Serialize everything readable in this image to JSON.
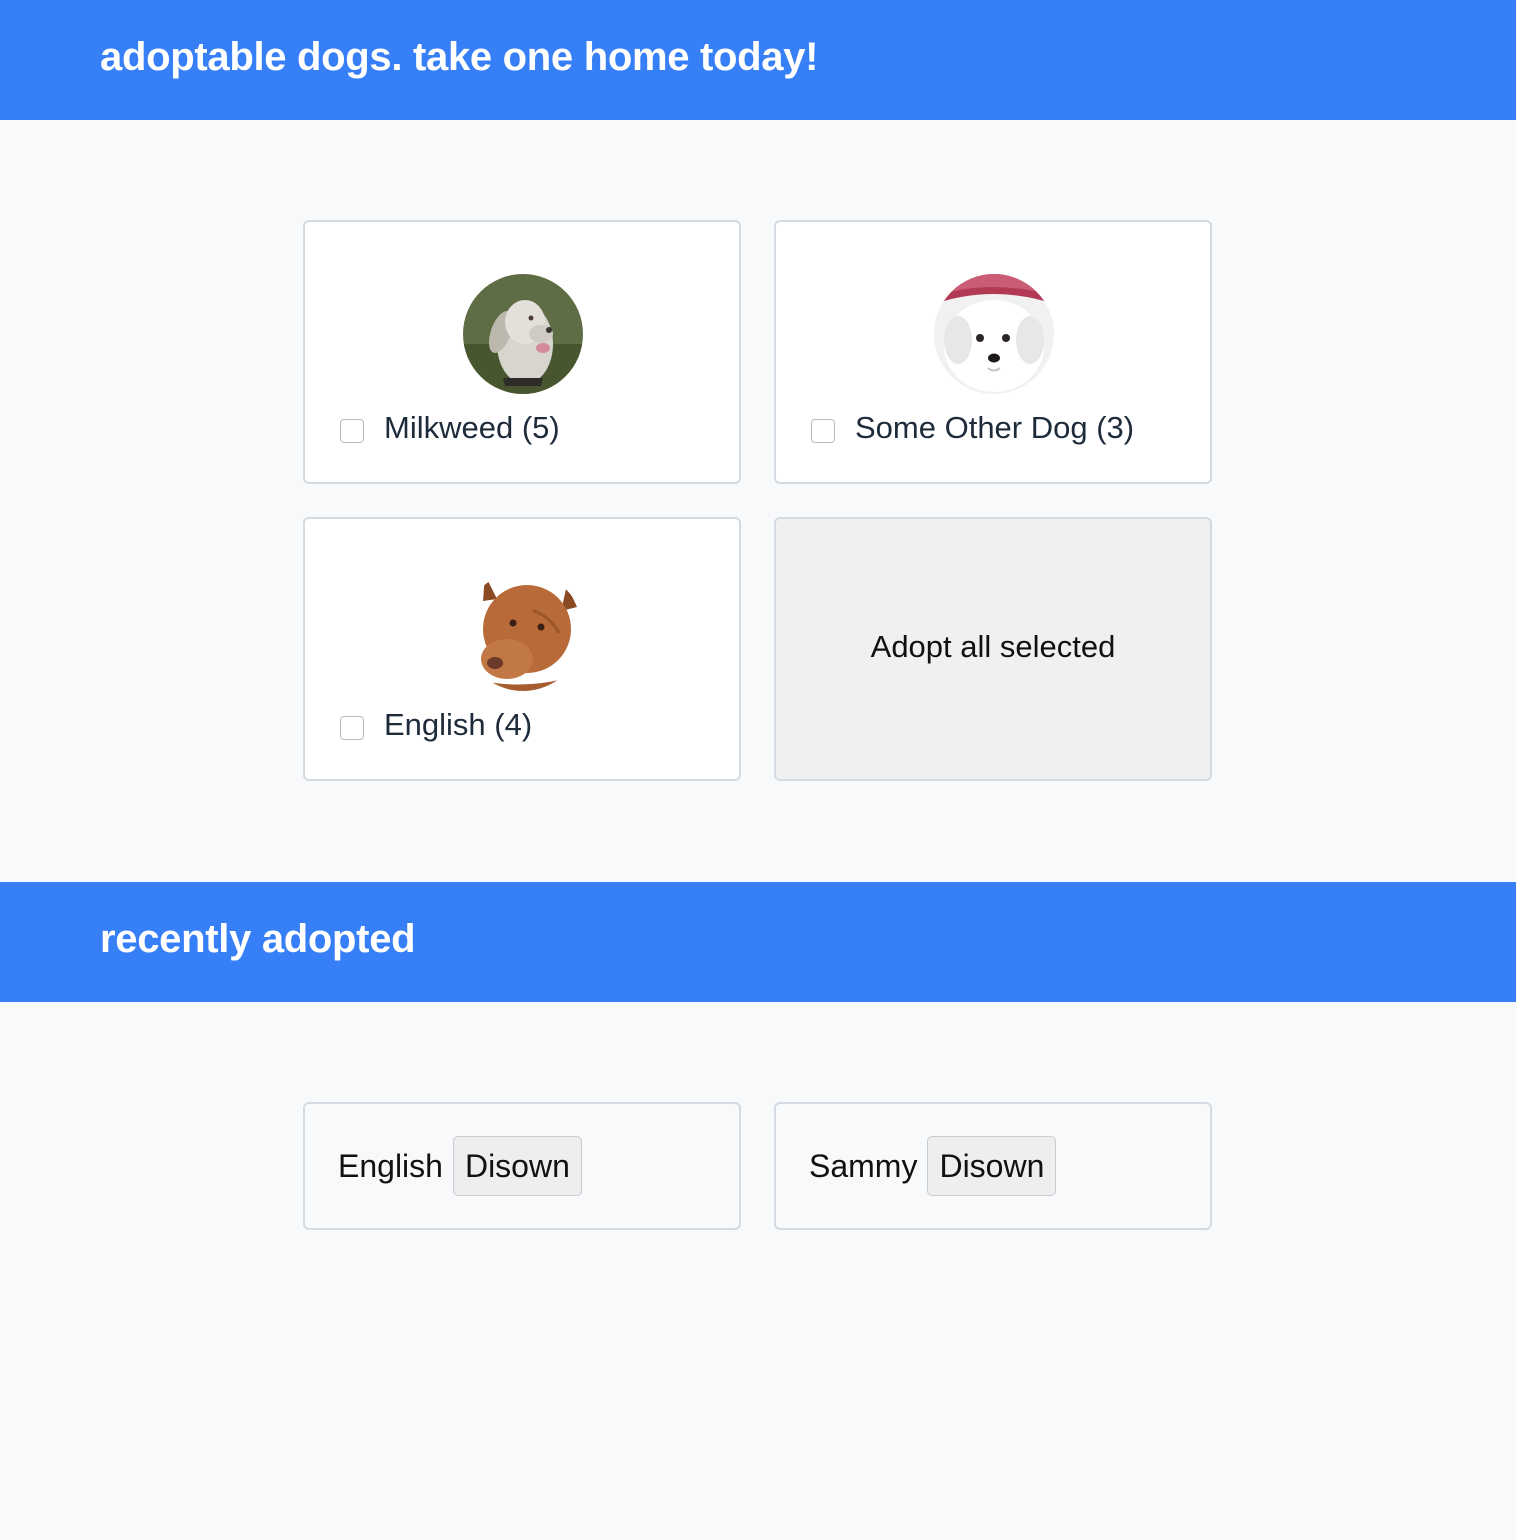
{
  "header": {
    "title": "adoptable dogs. take one home today!"
  },
  "dogs": [
    {
      "label": "Milkweed (5)",
      "avatar_icon": "weimaraner-dog-photo",
      "checked": false
    },
    {
      "label": "Some Other Dog (3)",
      "avatar_icon": "white-fluffy-puppy-photo",
      "checked": false
    },
    {
      "label": "English (4)",
      "avatar_icon": "brown-pit-bull-photo",
      "checked": false
    }
  ],
  "adopt_button": {
    "label": "Adopt all selected"
  },
  "recent": {
    "title": "recently adopted",
    "items": [
      {
        "name": "English",
        "button_label": "Disown"
      },
      {
        "name": "Sammy",
        "button_label": "Disown"
      }
    ]
  },
  "colors": {
    "banner": "#377ff7",
    "page_background": "#f8f9fb",
    "card_border": "#d4d9e2",
    "adopt_button_background": "#f0f0f0"
  }
}
